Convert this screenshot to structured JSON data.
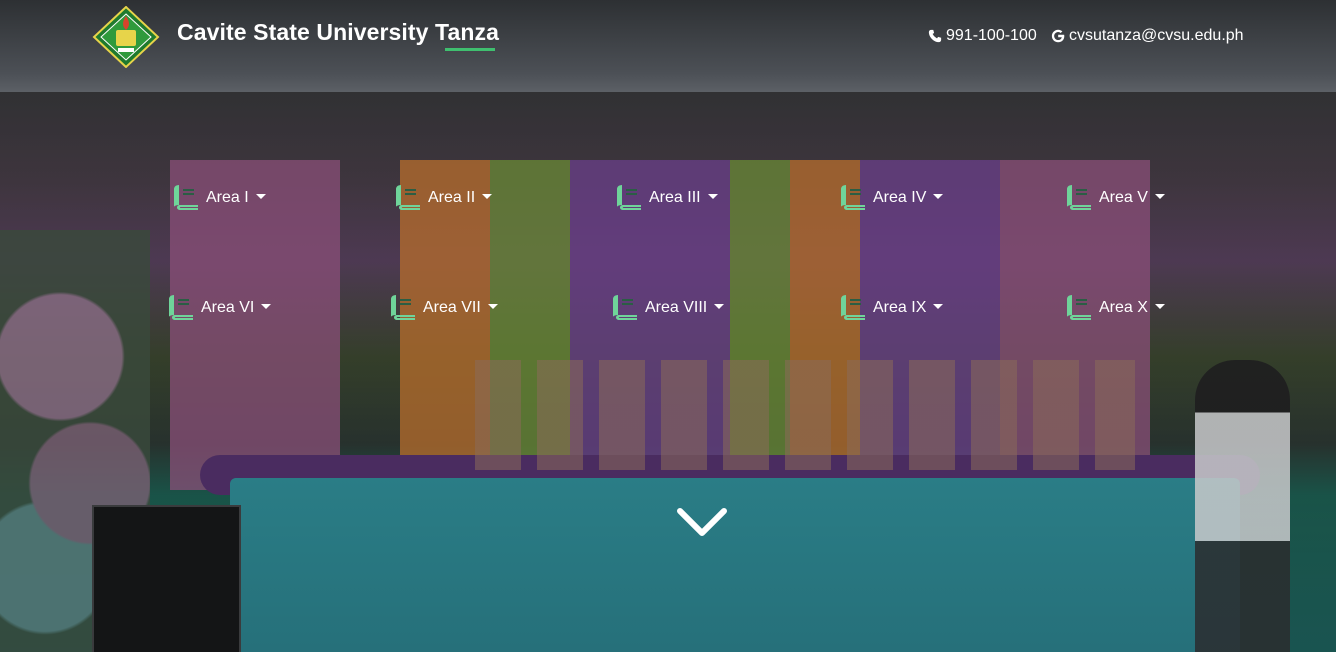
{
  "header": {
    "title": "Cavite State University Tanza",
    "phone": "991-100-100",
    "email": "cvsutanza@cvsu.edu.ph"
  },
  "areas": [
    {
      "label": "Area I"
    },
    {
      "label": "Area II"
    },
    {
      "label": "Area III"
    },
    {
      "label": "Area IV"
    },
    {
      "label": "Area V"
    },
    {
      "label": "Area VI"
    },
    {
      "label": "Area VII"
    },
    {
      "label": "Area VIII"
    },
    {
      "label": "Area IX"
    },
    {
      "label": "Area X"
    }
  ],
  "icons": {
    "phone": "phone-icon",
    "email": "google-icon",
    "area": "book-icon",
    "dropdown": "caret-down-icon",
    "scroll": "chevron-down-icon"
  },
  "colors": {
    "accent": "#3fbf6f",
    "book_icon": "#6fd49a",
    "text": "#ffffff"
  }
}
